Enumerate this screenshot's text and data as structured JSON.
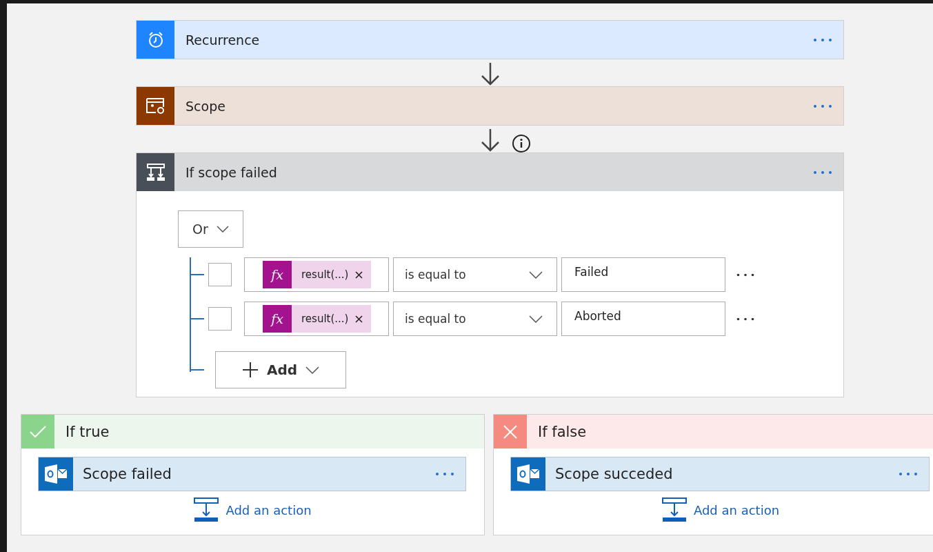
{
  "steps": [
    {
      "kind": "trigger",
      "title": "Recurrence",
      "color": "#1f85ff"
    },
    {
      "kind": "scope",
      "title": "Scope",
      "color": "#8c3900"
    },
    {
      "kind": "condition",
      "title": "If scope failed",
      "color": "#484f58"
    }
  ],
  "condition": {
    "group_operator": "Or",
    "rows": [
      {
        "checked": false,
        "token_icon": "fx",
        "token": "result(...)",
        "operator": "is equal to",
        "value": "Failed"
      },
      {
        "checked": false,
        "token_icon": "fx",
        "token": "result(...)",
        "operator": "is equal to",
        "value": "Aborted"
      }
    ],
    "add_label": "Add"
  },
  "branches": [
    {
      "kind": "true",
      "title": "If true",
      "action": "Scope failed",
      "add_label": "Add an action"
    },
    {
      "kind": "false",
      "title": "If false",
      "action": "Scope succeded",
      "add_label": "Add an action"
    }
  ]
}
